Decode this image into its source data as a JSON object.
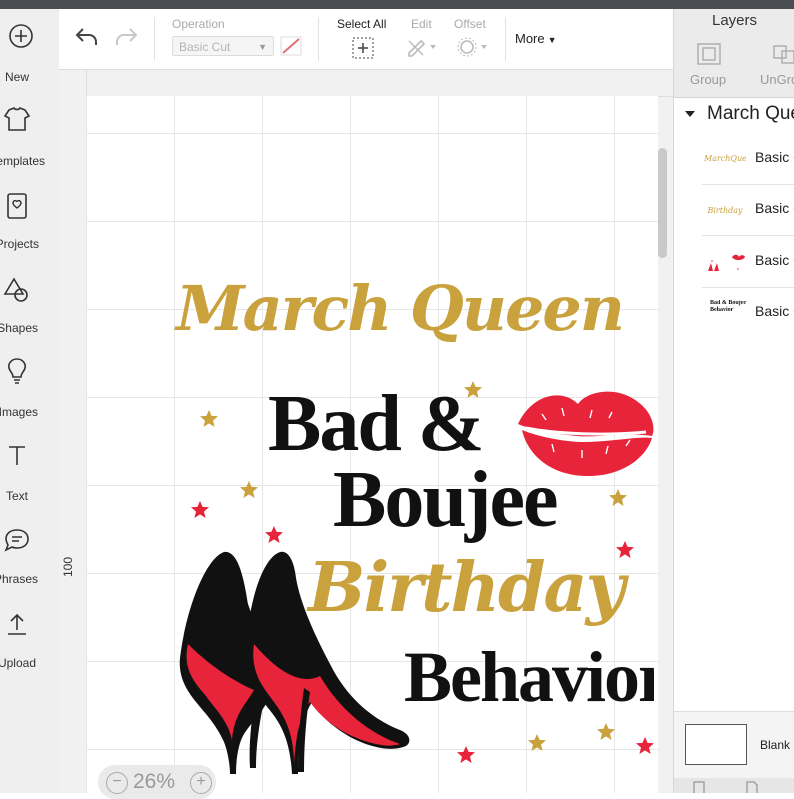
{
  "sidebar": {
    "items": [
      {
        "label": "New",
        "icon": "plus-circle-icon"
      },
      {
        "label": "Templates",
        "icon": "tshirt-icon"
      },
      {
        "label": "Projects",
        "icon": "projects-icon"
      },
      {
        "label": "Shapes",
        "icon": "shapes-icon"
      },
      {
        "label": "Images",
        "icon": "lightbulb-icon"
      },
      {
        "label": "Text",
        "icon": "text-icon"
      },
      {
        "label": "Phrases",
        "icon": "speech-bubble-icon"
      },
      {
        "label": "Upload",
        "icon": "upload-icon"
      }
    ]
  },
  "toolbar": {
    "operation_label": "Operation",
    "operation_value": "Basic Cut",
    "select_all_label": "Select All",
    "edit_label": "Edit",
    "offset_label": "Offset",
    "more_label": "More"
  },
  "canvas": {
    "ruler_value": "100",
    "zoom_value": "26%",
    "design": {
      "line1": "March Queen",
      "line2": "Bad &",
      "line3": "Boujee",
      "line4": "Birthday",
      "line5": "Behavior"
    },
    "colors": {
      "gold": "#c9a13d",
      "red": "#e8243a",
      "black": "#111111"
    }
  },
  "layers_panel": {
    "title": "Layers",
    "group_label": "Group",
    "ungroup_label": "UnGroup",
    "group_name": "March Queen",
    "layers": [
      {
        "name": "Basic Cut",
        "thumb_text": "MarchQueen"
      },
      {
        "name": "Basic Cut",
        "thumb_text": "Birthday"
      },
      {
        "name": "Basic Cut",
        "thumb_text": ""
      },
      {
        "name": "Basic Cut",
        "thumb_text": "Bad & Boujee Behavior"
      }
    ],
    "canvas_label": "Blank Canvas"
  }
}
